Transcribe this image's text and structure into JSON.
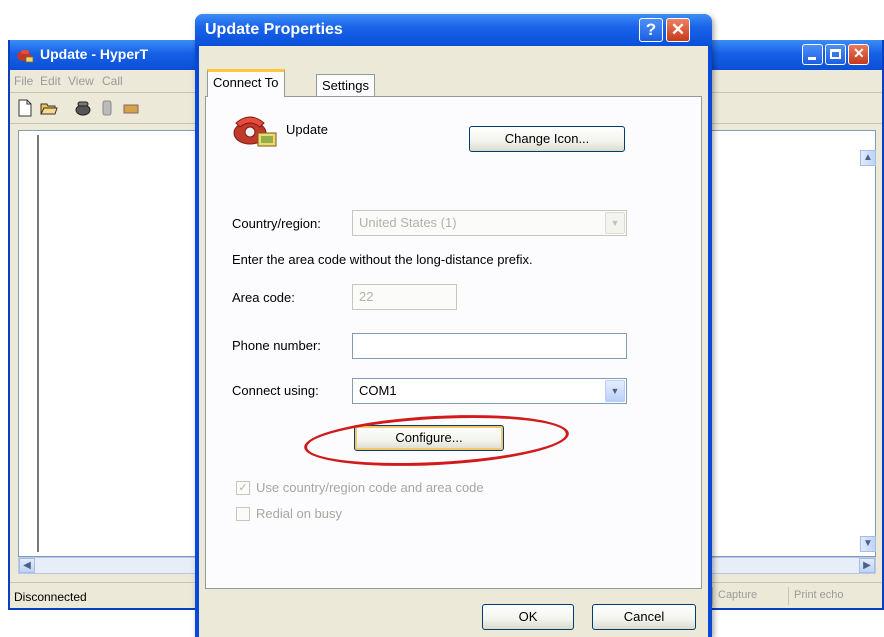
{
  "background_window": {
    "title": "Update - HyperT",
    "menu": [
      "File",
      "Edit",
      "View",
      "Call"
    ],
    "toolbar_icons": [
      "new-icon",
      "open-icon",
      "call-icon",
      "disconnect-icon",
      "send-icon"
    ],
    "status": {
      "connection": "Disconnected",
      "items": [
        "Capture",
        "Print echo"
      ]
    }
  },
  "dialog": {
    "title": "Update Properties",
    "help_label": "?",
    "tabs": [
      {
        "label": "Connect To",
        "active": true
      },
      {
        "label": "Settings",
        "active": false
      }
    ],
    "connection_name": "Update",
    "change_icon_label": "Change Icon...",
    "country_label": "Country/region:",
    "country_value": "United States (1)",
    "instruction": "Enter the area code without the long-distance prefix.",
    "area_code_label": "Area code:",
    "area_code_value": "22",
    "phone_label": "Phone number:",
    "phone_value": "",
    "connect_using_label": "Connect using:",
    "connect_using_value": "COM1",
    "configure_label": "Configure...",
    "use_country_label": "Use country/region code and area code",
    "use_country_checked": true,
    "redial_label": "Redial on busy",
    "redial_checked": false,
    "ok_label": "OK",
    "cancel_label": "Cancel"
  },
  "colors": {
    "titlebar_blue": "#0a4fd8",
    "dialog_face": "#ece9d8",
    "annotation_red": "#d11b1b"
  }
}
